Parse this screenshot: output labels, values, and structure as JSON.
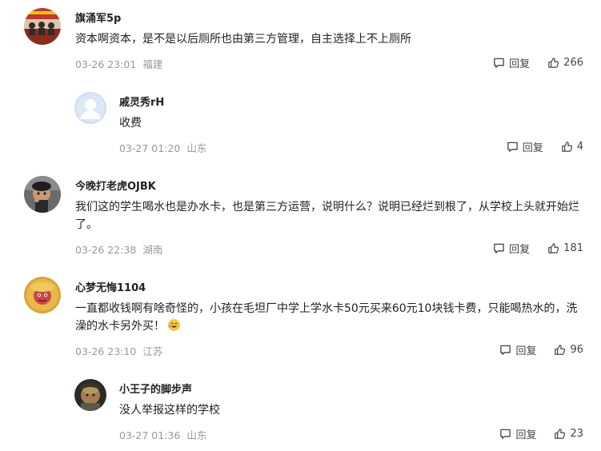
{
  "comments": [
    {
      "user": "旗涌军5p",
      "text": "资本啊资本，是不是以后厕所也由第三方管理，自主选择上不上厕所",
      "date": "03-26 23:01",
      "location": "福建",
      "reply_label": "回复",
      "likes": "266"
    },
    {
      "user": "戚灵秀rH",
      "text": "收费",
      "date": "03-27 01:20",
      "location": "山东",
      "reply_label": "回复",
      "likes": "4"
    },
    {
      "user": "今晚打老虎OJBK",
      "text": "我们这的学生喝水也是办水卡，也是第三方运营，说明什么？说明已经烂到根了，从学校上头就开始烂了。",
      "date": "03-26 22:38",
      "location": "湖南",
      "reply_label": "回复",
      "likes": "181"
    },
    {
      "user": "心梦无悔1104",
      "text": "一直都收钱啊有啥奇怪的，小孩在毛坦厂中学上学水卡50元买来60元10块钱卡费，只能喝热水的，洗澡的水卡另外买！",
      "date": "03-26 23:10",
      "location": "江苏",
      "reply_label": "回复",
      "likes": "96"
    },
    {
      "user": "小王子的脚步声",
      "text": "没人举报这样的学校",
      "date": "03-27 01:36",
      "location": "山东",
      "reply_label": "回复",
      "likes": "23"
    }
  ]
}
